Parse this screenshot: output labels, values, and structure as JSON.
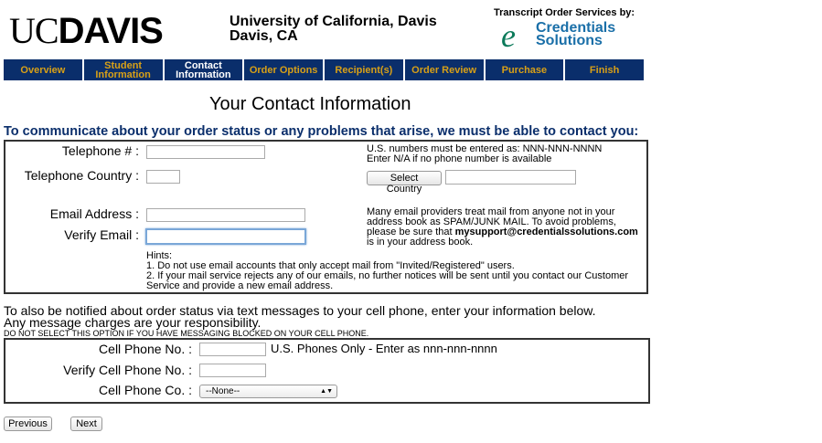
{
  "header": {
    "logo_uc": "UC",
    "logo_davis": "DAVIS",
    "university_line1": "University of California, Davis",
    "university_line2": "Davis, CA",
    "services_label": "Transcript Order Services by:",
    "partner_logo_e": "e",
    "partner_logo_line1": "Credentials",
    "partner_logo_line2": "Solutions"
  },
  "nav": {
    "tabs": [
      {
        "label": "Overview"
      },
      {
        "label": "Student Information"
      },
      {
        "label": "Contact Information",
        "active": true
      },
      {
        "label": "Order Options"
      },
      {
        "label": "Recipient(s)"
      },
      {
        "label": "Order Review"
      },
      {
        "label": "Purchase"
      },
      {
        "label": "Finish"
      }
    ]
  },
  "page": {
    "title": "Your Contact Information",
    "intro": "To communicate about your order status or any problems that arise, we must be able to contact you:"
  },
  "contact": {
    "telephone_label": "Telephone # :",
    "telephone_value": "",
    "telephone_note1": "U.S. numbers must be entered as: NNN-NNN-NNNN",
    "telephone_note2": "Enter N/A if no phone number is available",
    "country_label": "Telephone Country :",
    "country_value": "",
    "select_country_label": "Select Country",
    "country_name_value": "",
    "email_label": "Email Address :",
    "email_value": "",
    "verify_email_label": "Verify Email :",
    "verify_email_value": "",
    "spam_note_a": "Many email providers treat mail from anyone not in your address book as SPAM/JUNK MAIL. To avoid problems, please be sure that ",
    "spam_note_email": "mysupport@credentialssolutions.com",
    "spam_note_b": " is in your address book.",
    "hints_title": "Hints:",
    "hint1": "1. Do not use email accounts that only accept mail from \"Invited/Registered\" users.",
    "hint2": "2. If your mail service rejects any of our emails, no further notices will be sent until you contact our Customer Service and provide a new email address."
  },
  "sms": {
    "intro1": "To also be notified about order status via text messages to your cell phone, enter your information below.",
    "intro2": "Any message charges are your responsibility.",
    "warning": "DO NOT SELECT THIS OPTION IF YOU HAVE MESSAGING BLOCKED ON YOUR CELL PHONE.",
    "cell_label": "Cell Phone No. :",
    "cell_value": "",
    "cell_note": "U.S. Phones Only - Enter as nnn-nnn-nnnn",
    "verify_cell_label": "Verify Cell Phone No. :",
    "verify_cell_value": "",
    "carrier_label": "Cell Phone Co. :",
    "carrier_selected": "--None--"
  },
  "buttons": {
    "previous": "Previous",
    "next": "Next"
  },
  "colors": {
    "nav_bg": "#0a2e6b",
    "nav_text": "#d8a017",
    "intro_text": "#0a2e6b",
    "partner_green": "#0b7a5a",
    "partner_blue": "#1a6fa8"
  }
}
